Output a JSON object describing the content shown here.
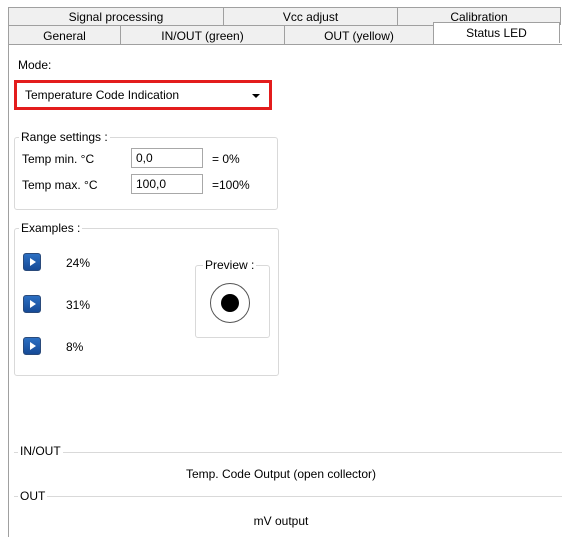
{
  "tabs_back": [
    "Signal processing",
    "Vcc adjust",
    "Calibration"
  ],
  "tabs_front": [
    "General",
    "IN/OUT (green)",
    "OUT (yellow)",
    "Status LED"
  ],
  "mode": {
    "legend": "Mode:",
    "selected": "Temperature Code Indication"
  },
  "range": {
    "legend": "Range settings :",
    "min_label": "Temp min. °C",
    "min_value": "0,0",
    "min_suffix": "= 0%",
    "max_label": "Temp max. °C",
    "max_value": "100,0",
    "max_suffix": "=100%"
  },
  "examples": {
    "legend": "Examples :",
    "items": [
      "24%",
      "31%",
      "8%"
    ],
    "preview_legend": "Preview :"
  },
  "inout": {
    "legend": "IN/OUT",
    "value": "Temp. Code Output (open collector)"
  },
  "out": {
    "legend": "OUT",
    "value": "mV output"
  },
  "colors": {
    "highlight": "#e31c1c",
    "button": "#1f5fae"
  }
}
